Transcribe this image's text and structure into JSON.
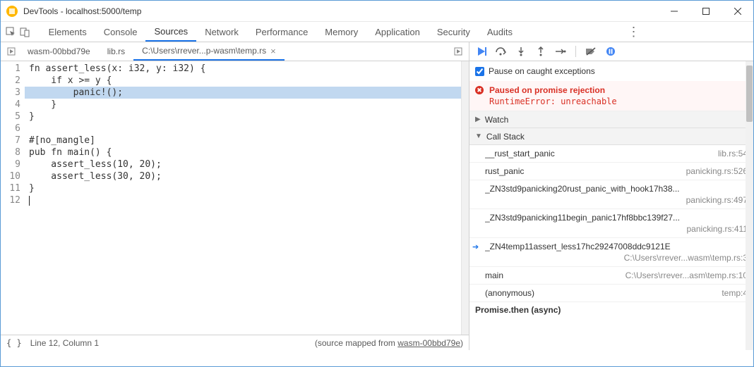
{
  "window": {
    "title": "DevTools - localhost:5000/temp"
  },
  "main_tabs": {
    "items": [
      "Elements",
      "Console",
      "Sources",
      "Network",
      "Performance",
      "Memory",
      "Application",
      "Security",
      "Audits"
    ],
    "active_index": 2
  },
  "file_tabs": {
    "items": [
      {
        "label": "wasm-00bbd79e",
        "active": false,
        "closable": false
      },
      {
        "label": "lib.rs",
        "active": false,
        "closable": false
      },
      {
        "label": "C:\\Users\\rrever...p-wasm\\temp.rs",
        "active": true,
        "closable": true
      }
    ]
  },
  "editor": {
    "highlight_line": 3,
    "cursor_line": 12,
    "lines": [
      "fn assert_less(x: i32, y: i32) {",
      "    if x >= y {",
      "        panic!();",
      "    }",
      "}",
      "",
      "#[no_mangle]",
      "pub fn main() {",
      "    assert_less(10, 20);",
      "    assert_less(30, 20);",
      "}",
      ""
    ]
  },
  "status": {
    "cursor": "Line 12, Column 1",
    "mapped_prefix": "(source mapped from ",
    "mapped_link": "wasm-00bbd79e",
    "mapped_suffix": ")"
  },
  "debugger": {
    "pause_checkbox_label": "Pause on caught exceptions",
    "pause_checked": true,
    "banner": {
      "title": "Paused on promise rejection",
      "detail": "RuntimeError: unreachable"
    },
    "sections": {
      "watch": "Watch",
      "callstack": "Call Stack"
    },
    "callstack": [
      {
        "name": "__rust_start_panic",
        "loc": "lib.rs:54",
        "current": false,
        "twoline": false
      },
      {
        "name": "rust_panic",
        "loc": "panicking.rs:526",
        "current": false,
        "twoline": false
      },
      {
        "name": "_ZN3std9panicking20rust_panic_with_hook17h38...",
        "loc": "panicking.rs:497",
        "current": false,
        "twoline": true
      },
      {
        "name": "_ZN3std9panicking11begin_panic17hf8bbc139f27...",
        "loc": "panicking.rs:411",
        "current": false,
        "twoline": true
      },
      {
        "name": "_ZN4temp11assert_less17hc29247008ddc9121E",
        "loc": "C:\\Users\\rrever...wasm\\temp.rs:3",
        "current": true,
        "twoline": true
      },
      {
        "name": "main",
        "loc": "C:\\Users\\rrever...asm\\temp.rs:10",
        "current": false,
        "twoline": false
      },
      {
        "name": "(anonymous)",
        "loc": "temp:4",
        "current": false,
        "twoline": false
      }
    ],
    "async_label": "Promise.then (async)"
  }
}
